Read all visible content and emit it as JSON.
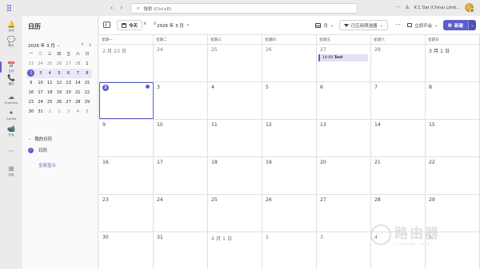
{
  "search": {
    "placeholder": "搜索 (Ctrl+E)"
  },
  "header": {
    "tenant": "K C Dat (China) Limit..."
  },
  "rail": [
    {
      "icon": "activity-icon",
      "label": "活动",
      "glyph": "🔔"
    },
    {
      "icon": "chat-icon",
      "label": "聊天",
      "glyph": "💬"
    },
    {
      "icon": "calendar-icon",
      "label": "日历",
      "glyph": "📅",
      "active": true
    },
    {
      "icon": "calls-icon",
      "label": "通话",
      "glyph": "📞"
    },
    {
      "icon": "onedrive-icon",
      "label": "OneDrive",
      "glyph": "☁"
    },
    {
      "icon": "copilot-icon",
      "label": "Copilot",
      "glyph": "✦"
    },
    {
      "icon": "meet-icon",
      "label": "开会",
      "glyph": "📹"
    },
    {
      "icon": "more-apps-icon",
      "label": "",
      "glyph": "···"
    },
    {
      "icon": "apps-icon",
      "label": "应用",
      "glyph": "⊞"
    }
  ],
  "sidebar": {
    "title": "日历",
    "mini_month": "2026 年 3 月",
    "weekdays": [
      "一",
      "二",
      "三",
      "四",
      "五",
      "六",
      "日"
    ],
    "weeks": [
      [
        "23",
        "24",
        "25",
        "26",
        "27",
        "28",
        "1"
      ],
      [
        "2",
        "3",
        "4",
        "5",
        "6",
        "7",
        "8"
      ],
      [
        "9",
        "10",
        "11",
        "12",
        "13",
        "14",
        "15"
      ],
      [
        "16",
        "17",
        "18",
        "19",
        "20",
        "21",
        "22"
      ],
      [
        "23",
        "24",
        "25",
        "26",
        "27",
        "28",
        "29"
      ],
      [
        "30",
        "31",
        "1",
        "2",
        "3",
        "4",
        "5"
      ]
    ],
    "my_calendars": "我的日历",
    "calendar_name": "日历",
    "show_all": "全部显示"
  },
  "toolbar": {
    "today": "今天",
    "month_label": "2026 年 3 月",
    "view": "月",
    "filter": "已应用筛选器",
    "meet_now": "立即开会",
    "new": "新建"
  },
  "calendar": {
    "weekdays": [
      "星期一",
      "星期二",
      "星期三",
      "星期四",
      "星期五",
      "星期六",
      "星期日"
    ],
    "weeks": [
      [
        "2 月 23 日",
        "24",
        "25",
        "26",
        "27",
        "28",
        "3 月 1 日"
      ],
      [
        "2",
        "3",
        "4",
        "5",
        "6",
        "7",
        "8"
      ],
      [
        "9",
        "10",
        "11",
        "12",
        "13",
        "14",
        "15"
      ],
      [
        "16",
        "17",
        "18",
        "19",
        "20",
        "21",
        "22"
      ],
      [
        "23",
        "24",
        "25",
        "26",
        "27",
        "28",
        "29"
      ],
      [
        "30",
        "31",
        "4 月 1 日",
        "2",
        "3",
        "4",
        "5"
      ]
    ],
    "event": {
      "time": "14:00",
      "title": "Test"
    }
  },
  "watermark": {
    "text": "路由器",
    "url": "luyouqi.com"
  },
  "colors": {
    "accent": "#5b5fc7"
  }
}
